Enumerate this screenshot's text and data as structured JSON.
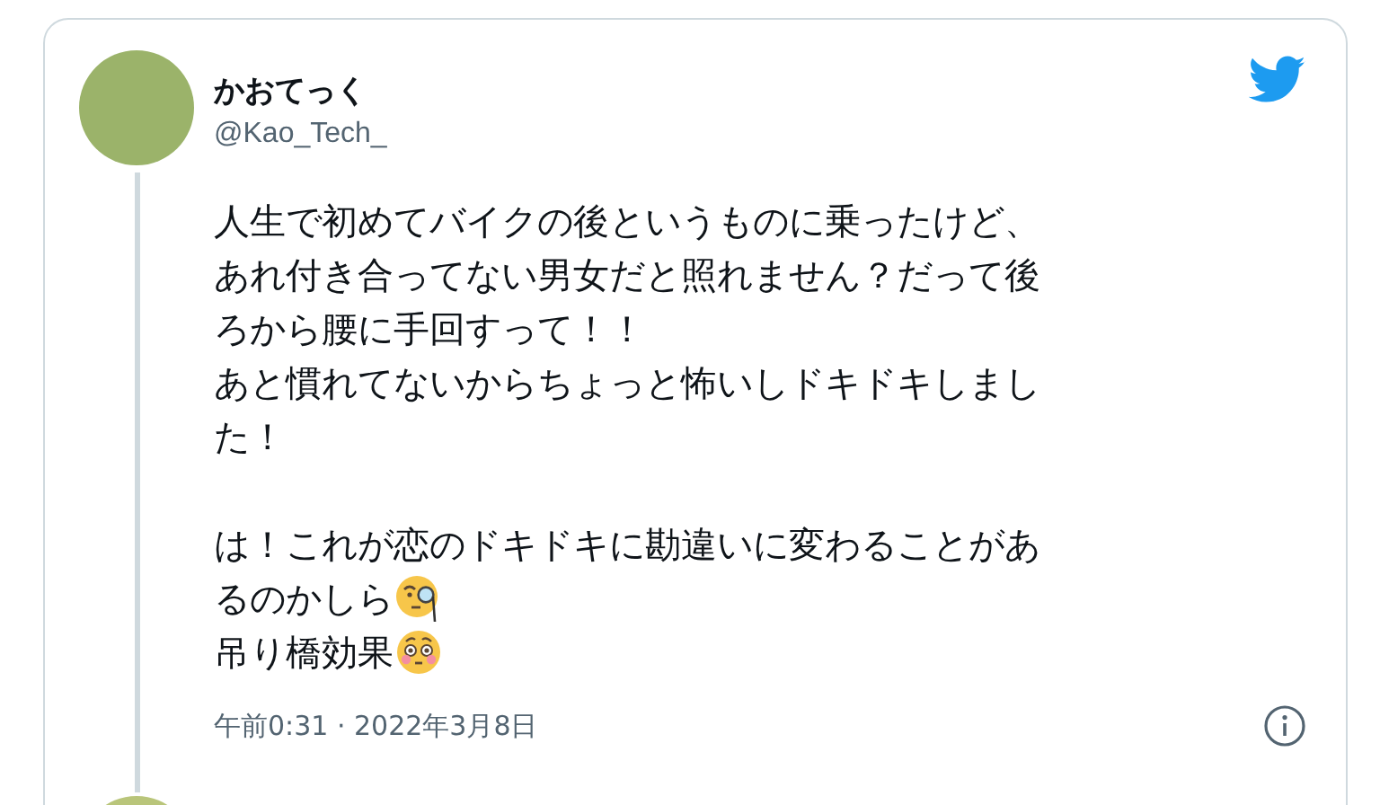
{
  "tweet": {
    "author": {
      "name": "かおてっく",
      "handle": "@Kao_Tech_"
    },
    "paragraphs": [
      {
        "lines": [
          {
            "text": "人生で初めてバイクの後というものに乗ったけど、"
          },
          {
            "text": "あれ付き合ってない男女だと照れません？だって後"
          },
          {
            "text": "ろから腰に手回すって！！"
          },
          {
            "text": "あと慣れてないからちょっと怖いしドキドキしまし"
          },
          {
            "text": "た！"
          }
        ]
      },
      {
        "lines": [
          {
            "text": "は！これが恋のドキドキに勘違いに変わることがあ"
          },
          {
            "text": "るのかしら",
            "kind": "monocle"
          },
          {
            "text": "吊り橋効果",
            "kind": "flushed"
          }
        ]
      }
    ],
    "timestamp": "午前0:31 · 2022年3月8日"
  }
}
